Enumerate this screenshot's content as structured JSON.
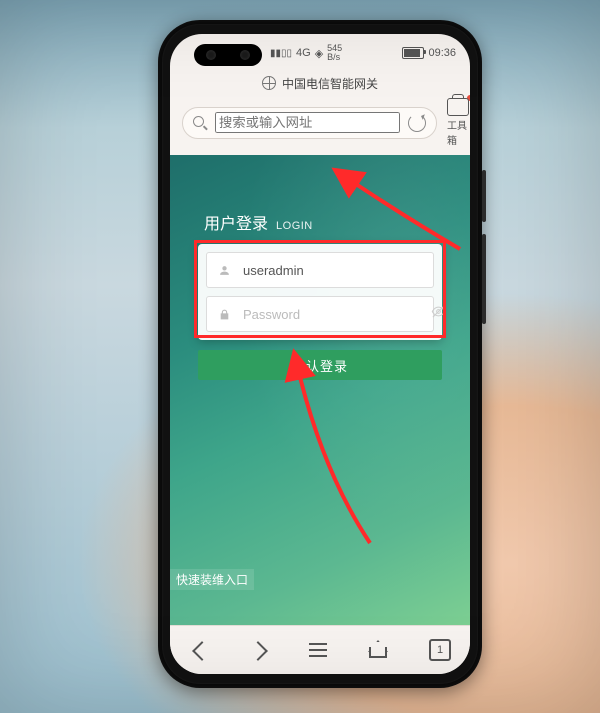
{
  "status": {
    "signal_label": "4G",
    "net_speed_top": "545",
    "net_speed_bottom": "B/s",
    "battery_icon_level": "80",
    "time": "09:36"
  },
  "browser": {
    "page_title": "中国电信智能网关",
    "search_placeholder": "搜索或输入网址",
    "toolbox_label": "工具箱"
  },
  "login": {
    "heading_zh": "用户登录",
    "heading_en": "LOGIN",
    "username_value": "useradmin",
    "password_placeholder": "Password",
    "submit_label": "确认登录"
  },
  "page": {
    "quick_link": "快速装维入口"
  },
  "nav": {
    "tab_count": "1"
  },
  "annotations": {
    "red_box_targets": "username+password fields",
    "arrow_count": 2
  }
}
